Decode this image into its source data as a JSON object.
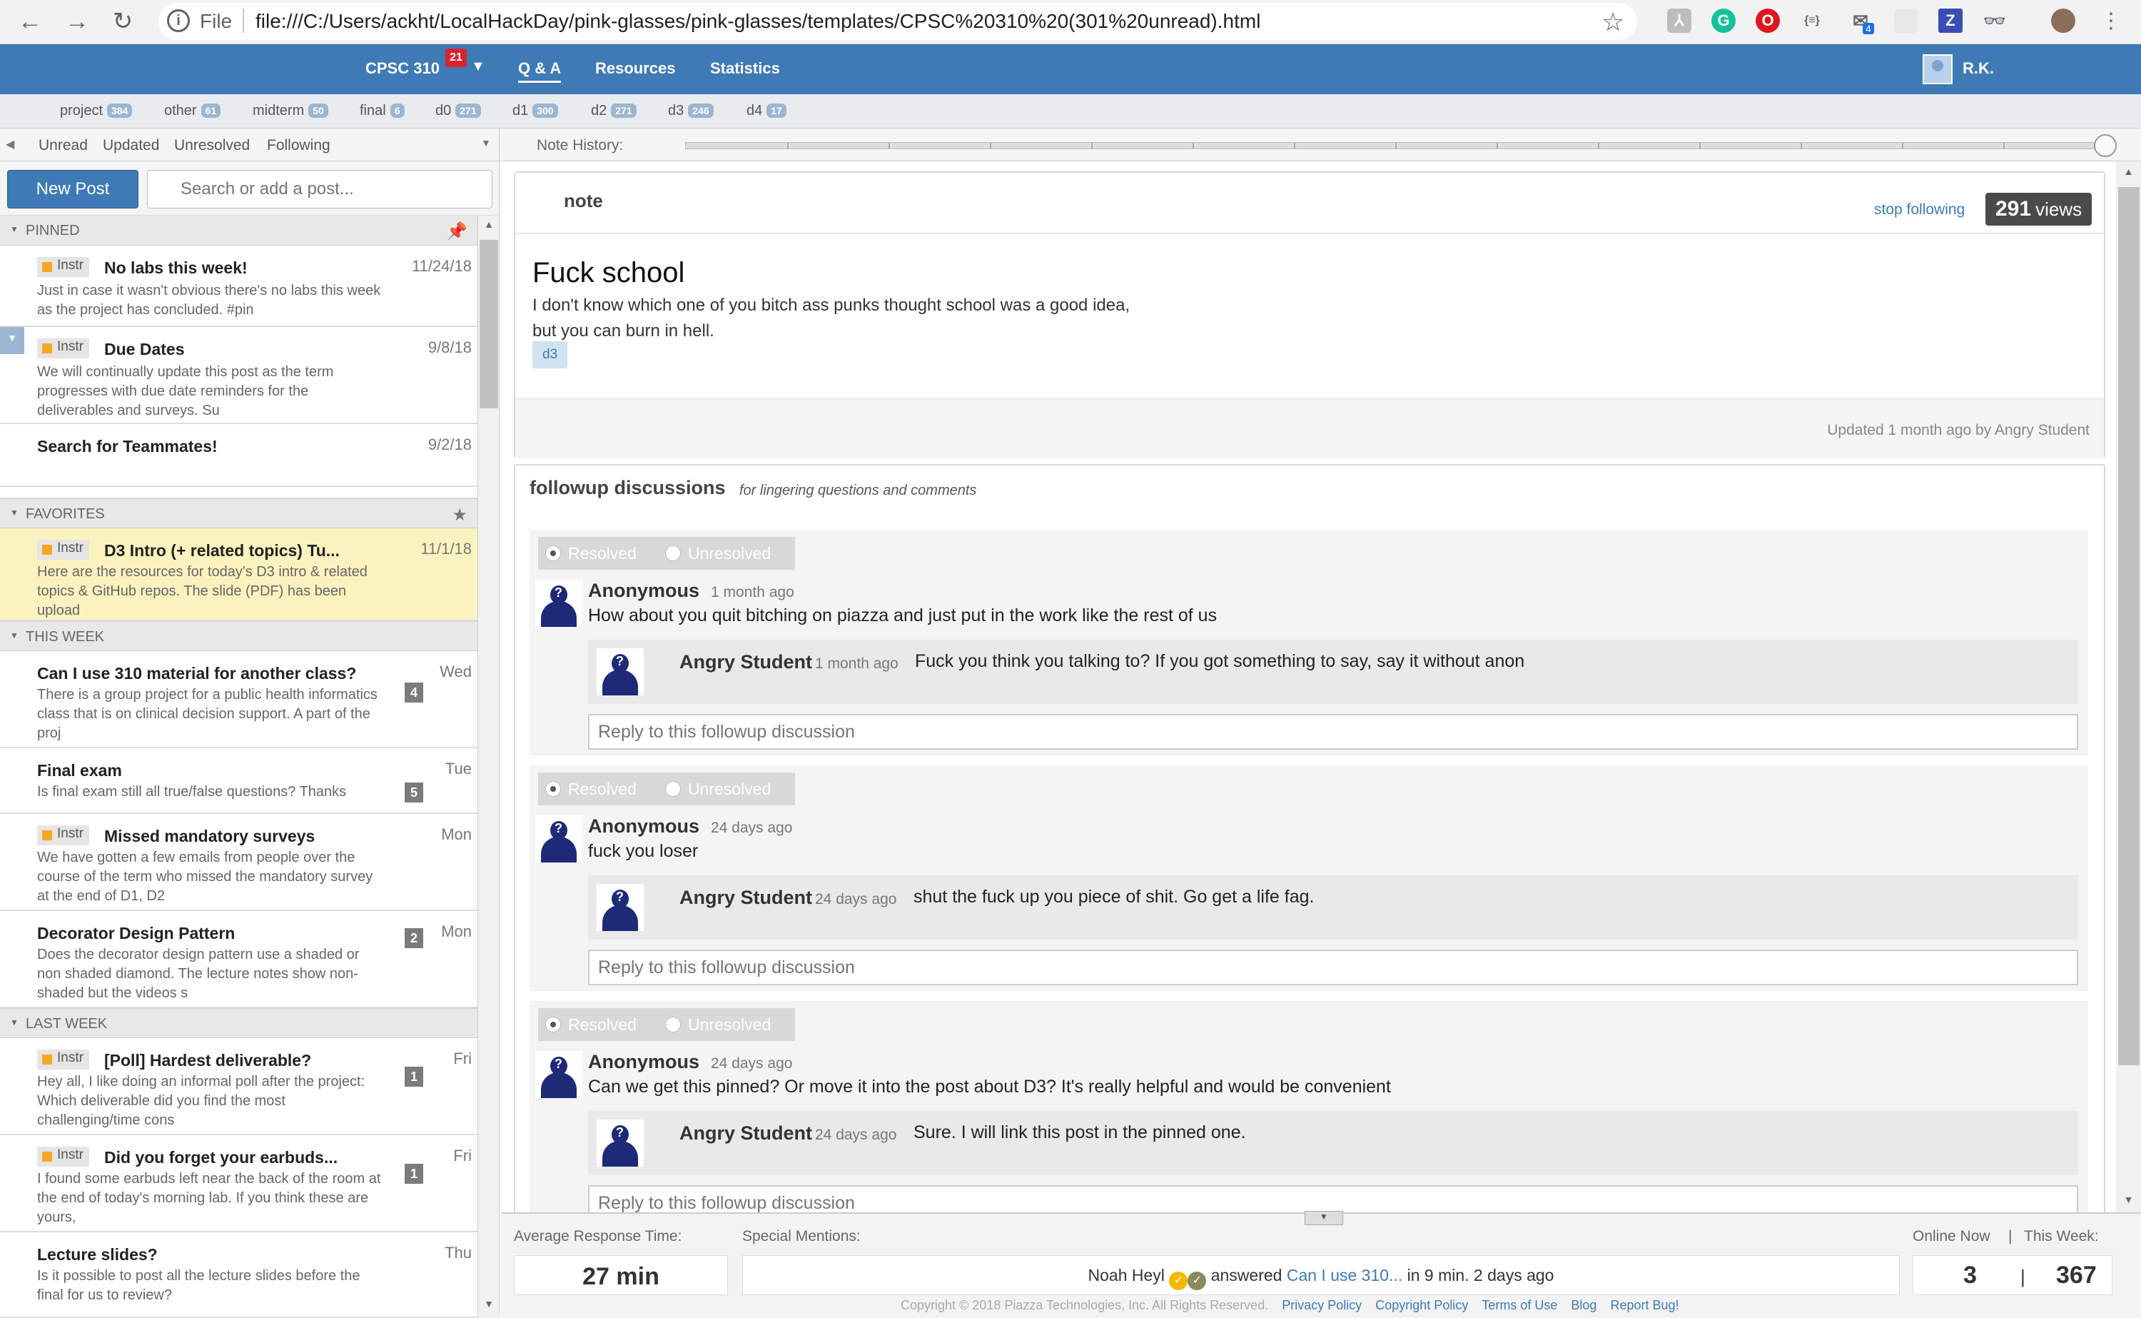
{
  "browser": {
    "file_label": "File",
    "url": "file:///C:/Users/ackht/LocalHackDay/pink-glasses/pink-glasses/templates/CPSC%20310%20(301%20unread).html",
    "extension_badge": "4"
  },
  "topnav": {
    "course": "CPSC 310",
    "course_badge": "21",
    "tabs": [
      "Q & A",
      "Resources",
      "Statistics"
    ],
    "user_name": "R.K."
  },
  "folders": [
    {
      "name": "project",
      "count": "384"
    },
    {
      "name": "other",
      "count": "61"
    },
    {
      "name": "midterm",
      "count": "50"
    },
    {
      "name": "final",
      "count": "6"
    },
    {
      "name": "d0",
      "count": "271"
    },
    {
      "name": "d1",
      "count": "300"
    },
    {
      "name": "d2",
      "count": "271"
    },
    {
      "name": "d3",
      "count": "246"
    },
    {
      "name": "d4",
      "count": "17"
    }
  ],
  "filters": [
    "Unread",
    "Updated",
    "Unresolved",
    "Following"
  ],
  "left": {
    "new_post": "New Post",
    "search_placeholder": "Search or add a post..."
  },
  "groups": {
    "pinned": "PINNED",
    "favorites": "FAVORITES",
    "this_week": "THIS WEEK",
    "last_week": "LAST WEEK"
  },
  "instr_label": "Instr",
  "posts": [
    {
      "title": "No labs this week!",
      "date": "11/24/18",
      "snippet": "Just in case it wasn't obvious there's no labs this week as the project has concluded. #pin"
    },
    {
      "title": "Due Dates",
      "date": "9/8/18",
      "snippet": "We will continually update this post as the term progresses with due date reminders for the deliverables and surveys. Su"
    },
    {
      "title": "Search for Teammates!",
      "date": "9/2/18",
      "snippet": ""
    },
    {
      "title": "D3 Intro (+ related topics) Tu...",
      "date": "11/1/18",
      "snippet": "Here are the resources for today's D3 intro & related topics & GitHub repos. The slide (PDF) has been upload"
    },
    {
      "title": "Can I use 310 material for another class?",
      "date": "Wed",
      "count": "4",
      "snippet": "There is a group project for a public health informatics class that is on clinical decision support. A part of the proj"
    },
    {
      "title": "Final exam",
      "date": "Tue",
      "count": "5",
      "snippet": "Is final exam still all true/false questions? Thanks"
    },
    {
      "title": "Missed mandatory surveys",
      "date": "Mon",
      "snippet": "We have gotten a few emails from people over the course of the term who missed the mandatory survey at the end of D1, D2"
    },
    {
      "title": "Decorator Design Pattern",
      "date": "Mon",
      "count": "2",
      "snippet": "Does the decorator design pattern use a shaded or non shaded diamond. The lecture notes show non-shaded but the videos s"
    },
    {
      "title": "[Poll] Hardest deliverable?",
      "date": "Fri",
      "count": "1",
      "snippet": "Hey all, I like doing an informal poll after the project: Which deliverable did you find the most challenging/time cons"
    },
    {
      "title": "Did you forget your earbuds...",
      "date": "Fri",
      "count": "1",
      "snippet": "I found some earbuds left near the back of the room at the end of today's morning lab. If you think these are yours,"
    },
    {
      "title": "Lecture slides?",
      "date": "Thu",
      "snippet": "Is it possible to post all the lecture slides before the final for us to review?"
    }
  ],
  "history": {
    "label": "Note History:"
  },
  "note": {
    "type": "note",
    "stop_following": "stop following",
    "views_count": "291",
    "views_label": "views",
    "title": "Fuck school",
    "body_line1": "I don't know which one of you bitch ass punks thought school was a good idea,",
    "body_line2": "but you can burn in hell.",
    "tag": "d3",
    "updated": "Updated 1 month ago by Angry Student"
  },
  "followups": {
    "title": "followup discussions",
    "subtitle": "for lingering questions and comments",
    "resolved": "Resolved",
    "unresolved": "Unresolved",
    "reply_placeholder": "Reply to this followup discussion",
    "threads": [
      {
        "author": "Anonymous",
        "time": "1 month ago",
        "text": "How about you quit bitching on piazza and just put in the work like the rest of us",
        "reply_author": "Angry Student",
        "reply_time": "1 month ago",
        "reply_text": "Fuck you think you talking to? If you got something to say, say it without anon"
      },
      {
        "author": "Anonymous",
        "time": "24 days ago",
        "text": "fuck you loser",
        "reply_author": "Angry Student",
        "reply_time": "24 days ago",
        "reply_text": "shut the fuck up you piece of shit. Go get a life fag."
      },
      {
        "author": "Anonymous",
        "time": "24 days ago",
        "text": "Can we get this pinned? Or move it into the post about D3? It's really helpful and would be convenient",
        "reply_author": "Angry Student",
        "reply_time": "24 days ago",
        "reply_text": "Sure. I will link this post in the pinned one."
      }
    ]
  },
  "stats": {
    "avg_label": "Average Response Time:",
    "avg_value": "27 min",
    "mentions_label": "Special Mentions:",
    "mention_user": "Noah Heyl",
    "mention_action": "answered",
    "mention_link": "Can I use 310...",
    "mention_suffix": "in 9 min. 2 days ago",
    "online_label": "Online Now",
    "label_sep": "|",
    "week_label": "This Week:",
    "online_value": "3",
    "week_value": "367"
  },
  "footer": {
    "copyright": "Copyright © 2018 Piazza Technologies, Inc. All Rights Reserved.",
    "links": [
      "Privacy Policy",
      "Copyright Policy",
      "Terms of Use",
      "Blog",
      "Report Bug!"
    ]
  },
  "colors": {
    "brand_blue": "#3e7ab5",
    "badge_red": "#d9232c",
    "instr_orange": "#f5a623",
    "favorite_yellow": "#fbf3bf"
  }
}
